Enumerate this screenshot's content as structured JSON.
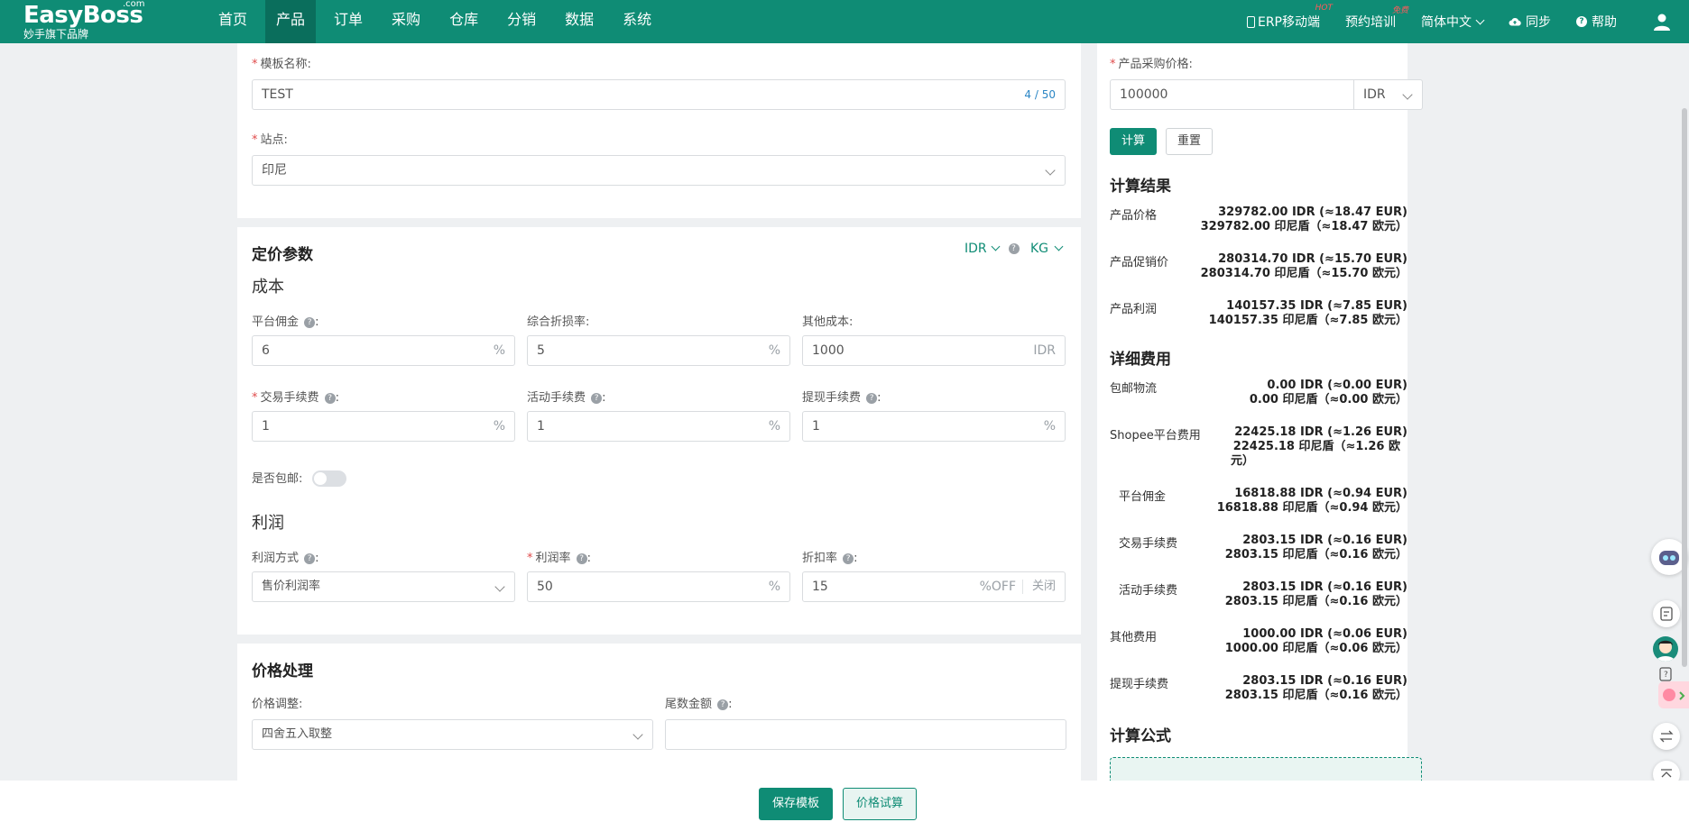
{
  "header": {
    "logo_com": ".com",
    "logo_brand": "EasyBoss",
    "logo_sub": "妙手旗下品牌",
    "nav": [
      "首页",
      "产品",
      "订单",
      "采购",
      "仓库",
      "分销",
      "数据",
      "系统"
    ],
    "right": {
      "erp": "ERP移动端",
      "erp_badge": "HOT",
      "training": "预约培训",
      "training_badge": "免费",
      "lang": "简体中文",
      "sync": "同步",
      "help": "帮助"
    }
  },
  "template": {
    "name_label": "模板名称:",
    "name_value": "TEST",
    "name_count": "4 / 50",
    "site_label": "站点:",
    "site_value": "印尼"
  },
  "pricing": {
    "title": "定价参数",
    "currency": "IDR",
    "weight": "KG",
    "cost_title": "成本",
    "commission_label": "平台佣金",
    "commission_value": "6",
    "loss_label": "综合折损率:",
    "loss_value": "5",
    "other_label": "其他成本:",
    "other_value": "1000",
    "other_unit": "IDR",
    "txn_label": "交易手续费",
    "txn_value": "1",
    "activity_label": "活动手续费",
    "activity_value": "1",
    "withdraw_label": "提现手续费",
    "withdraw_value": "1",
    "percent": "%",
    "freeship_label": "是否包邮:",
    "profit_title": "利润",
    "profit_method_label": "利润方式",
    "profit_method_value": "售价利润率",
    "profit_rate_label": "利润率",
    "profit_rate_value": "50",
    "discount_label": "折扣率",
    "discount_value": "15",
    "discount_unit": "%OFF",
    "discount_off": "关闭"
  },
  "price_processing": {
    "title": "价格处理",
    "adjust_label": "价格调整:",
    "adjust_value": "四舍五入取整",
    "tail_label": "尾数金额"
  },
  "calculator": {
    "purchase_label": "产品采购价格:",
    "purchase_value": "100000",
    "purchase_currency": "IDR",
    "calc_btn": "计算",
    "reset_btn": "重置",
    "result_title": "计算结果",
    "results": [
      {
        "label": "产品价格",
        "line1": "329782.00 IDR (≈18.47 EUR)",
        "line2": "329782.00 印尼盾（≈18.47 欧元）"
      },
      {
        "label": "产品促销价",
        "line1": "280314.70 IDR (≈15.70 EUR)",
        "line2": "280314.70 印尼盾（≈15.70 欧元）"
      },
      {
        "label": "产品利润",
        "line1": "140157.35 IDR (≈7.85 EUR)",
        "line2": "140157.35 印尼盾（≈7.85 欧元）"
      }
    ],
    "detail_title": "详细费用",
    "details": [
      {
        "label": "包邮物流",
        "line1": "0.00 IDR (≈0.00 EUR)",
        "line2": "0.00 印尼盾（≈0.00 欧元）",
        "line3": ""
      },
      {
        "label": "Shopee平台费用",
        "line1": "22425.18 IDR (≈1.26 EUR)",
        "line2": "22425.18 印尼盾（≈1.26 欧",
        "line3": "元）"
      },
      {
        "label": "平台佣金",
        "line1": "16818.88 IDR (≈0.94 EUR)",
        "line2": "16818.88 印尼盾（≈0.94 欧元）",
        "line3": ""
      },
      {
        "label": "交易手续费",
        "line1": "2803.15 IDR (≈0.16 EUR)",
        "line2": "2803.15 印尼盾（≈0.16 欧元）",
        "line3": ""
      },
      {
        "label": "活动手续费",
        "line1": "2803.15 IDR (≈0.16 EUR)",
        "line2": "2803.15 印尼盾（≈0.16 欧元）",
        "line3": ""
      },
      {
        "label": "其他费用",
        "line1": "1000.00 IDR (≈0.06 EUR)",
        "line2": "1000.00 印尼盾（≈0.06 欧元）",
        "line3": ""
      },
      {
        "label": "提现手续费",
        "line1": "2803.15 IDR (≈0.16 EUR)",
        "line2": "2803.15 印尼盾（≈0.16 欧元）",
        "line3": ""
      }
    ],
    "formula_title": "计算公式"
  },
  "bottom": {
    "save": "保存模板",
    "trial": "价格试算"
  },
  "colors": {
    "brand": "#0f8c75",
    "required": "#e04b4b",
    "link": "#2b86c5"
  }
}
